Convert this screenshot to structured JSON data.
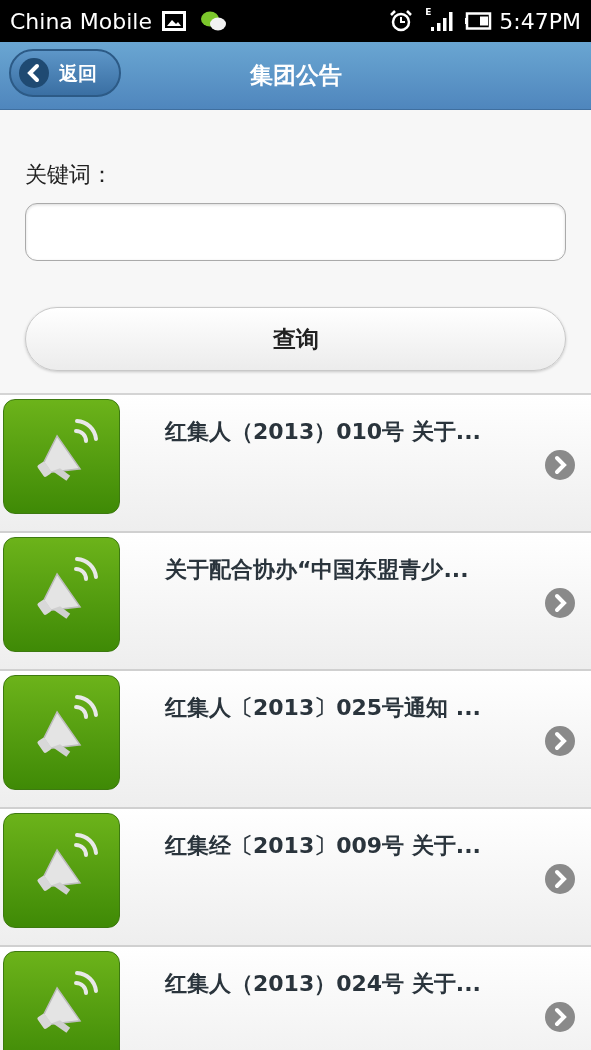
{
  "status_bar": {
    "carrier": "China Mobile",
    "time": "5:47PM",
    "network": "E"
  },
  "header": {
    "back": "返回",
    "title": "集团公告"
  },
  "search": {
    "label": "关键词：",
    "button": "查询"
  },
  "notices": [
    {
      "title": "红集人（2013）010号 关于..."
    },
    {
      "title": "关于配合协办“中国东盟青少..."
    },
    {
      "title": "红集人〔2013〕025号通知 ..."
    },
    {
      "title": "红集经〔2013〕009号 关于..."
    },
    {
      "title": "红集人（2013）024号 关于..."
    }
  ]
}
